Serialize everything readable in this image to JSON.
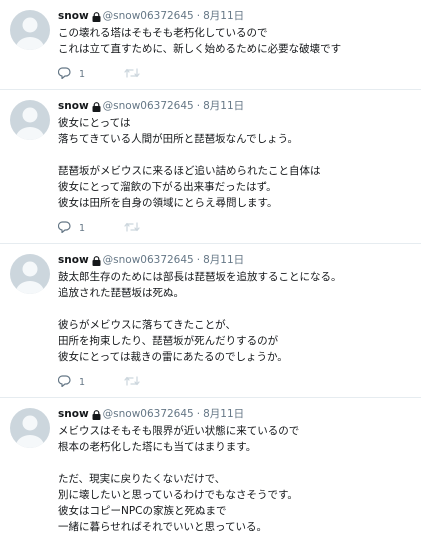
{
  "tweets": [
    {
      "user": {
        "name": "snow",
        "handle": "@snow06372645"
      },
      "separator": "·",
      "date": "8月11日",
      "text": "この壊れる塔はそもそも老朽化しているので\nこれは立て直すために、新しく始めるために必要な破壊です",
      "reply_count": "1"
    },
    {
      "user": {
        "name": "snow",
        "handle": "@snow06372645"
      },
      "separator": "·",
      "date": "8月11日",
      "text": "彼女にとっては\n落ちてきている人間が田所と琵琶坂なんでしょう。\n\n琵琶坂がメビウスに来るほど追い詰められたこと自体は\n彼女にとって溜飲の下がる出来事だったはず。\n彼女は田所を自身の領域にとらえ尋問します。",
      "reply_count": "1"
    },
    {
      "user": {
        "name": "snow",
        "handle": "@snow06372645"
      },
      "separator": "·",
      "date": "8月11日",
      "text": "鼓太郎生存のためには部長は琵琶坂を追放することになる。\n追放された琵琶坂は死ぬ。\n\n彼らがメビウスに落ちてきたことが、\n田所を拘束したり、琵琶坂が死んだりするのが\n彼女にとっては裁きの雷にあたるのでしょうか。",
      "reply_count": "1"
    },
    {
      "user": {
        "name": "snow",
        "handle": "@snow06372645"
      },
      "separator": "·",
      "date": "8月11日",
      "text": "メビウスはそもそも限界が近い状態に来ているので\n根本の老朽化した塔にも当てはまります。\n\nただ、現実に戻りたくないだけで、\n別に壊したいと思っているわけでもなさそうです。\n彼女はコピーNPCの家族と死ぬまで\n一緒に暮らせればそれでいいと思っている。",
      "reply_count": ""
    }
  ]
}
